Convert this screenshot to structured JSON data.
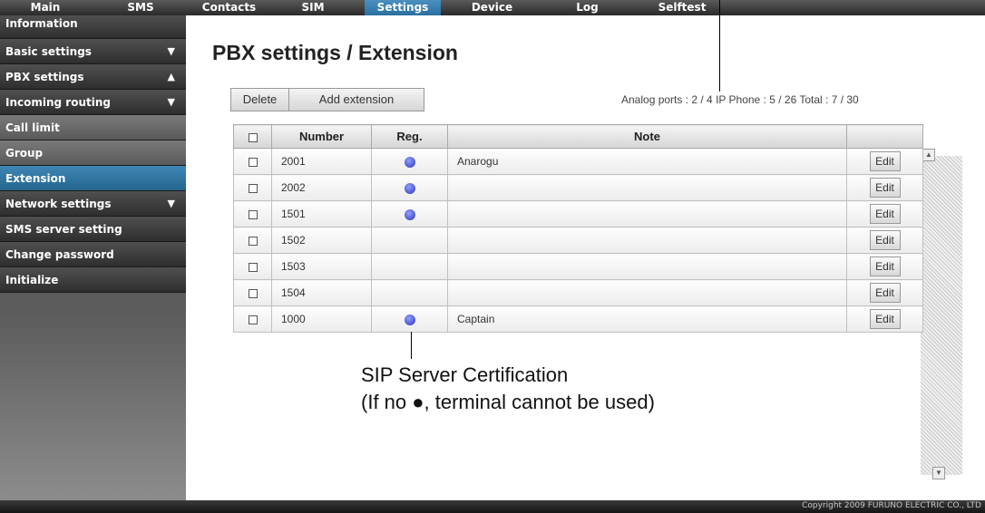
{
  "nav": {
    "tabs": [
      {
        "label": "Main"
      },
      {
        "label": "SMS"
      },
      {
        "label": "Contacts"
      },
      {
        "label": "SIM"
      },
      {
        "label": "Settings"
      },
      {
        "label": "Device"
      },
      {
        "label": "Log"
      },
      {
        "label": "Selftest"
      }
    ],
    "active_tab": "Settings"
  },
  "sidebar": {
    "items": [
      {
        "label": "Information"
      },
      {
        "label": "Basic settings",
        "arrow": "▼"
      },
      {
        "label": "PBX settings",
        "arrow": "▲"
      },
      {
        "label": "Incoming routing",
        "arrow": "▼"
      },
      {
        "label": "Call limit"
      },
      {
        "label": "Group"
      },
      {
        "label": "Extension"
      },
      {
        "label": "Network settings",
        "arrow": "▼"
      },
      {
        "label": "SMS server setting"
      },
      {
        "label": "Change password"
      },
      {
        "label": "Initialize"
      }
    ],
    "active_item": "Extension"
  },
  "page": {
    "title": "PBX settings / Extension",
    "delete_label": "Delete",
    "add_label": "Add extension",
    "counts": "Analog ports : 2 / 4   IP Phone : 5 / 26   Total : 7 / 30"
  },
  "table": {
    "headers": {
      "number": "Number",
      "reg": "Reg.",
      "note": "Note"
    },
    "edit_label": "Edit",
    "rows": [
      {
        "number": "2001",
        "registered": true,
        "note": "Anarogu"
      },
      {
        "number": "2002",
        "registered": true,
        "note": ""
      },
      {
        "number": "1501",
        "registered": true,
        "note": ""
      },
      {
        "number": "1502",
        "registered": false,
        "note": ""
      },
      {
        "number": "1503",
        "registered": false,
        "note": ""
      },
      {
        "number": "1504",
        "registered": false,
        "note": ""
      },
      {
        "number": "1000",
        "registered": true,
        "note": "Captain"
      }
    ]
  },
  "annotation": {
    "line1": "SIP Server Certification",
    "line2": "(If no ●, terminal cannot be used)"
  },
  "footer": {
    "copyright": "Copyright 2009 FURUNO ELECTRIC CO., LTD"
  },
  "colors": {
    "active_blue": "#2f7cab",
    "reg_dot": "#3a44c8"
  }
}
